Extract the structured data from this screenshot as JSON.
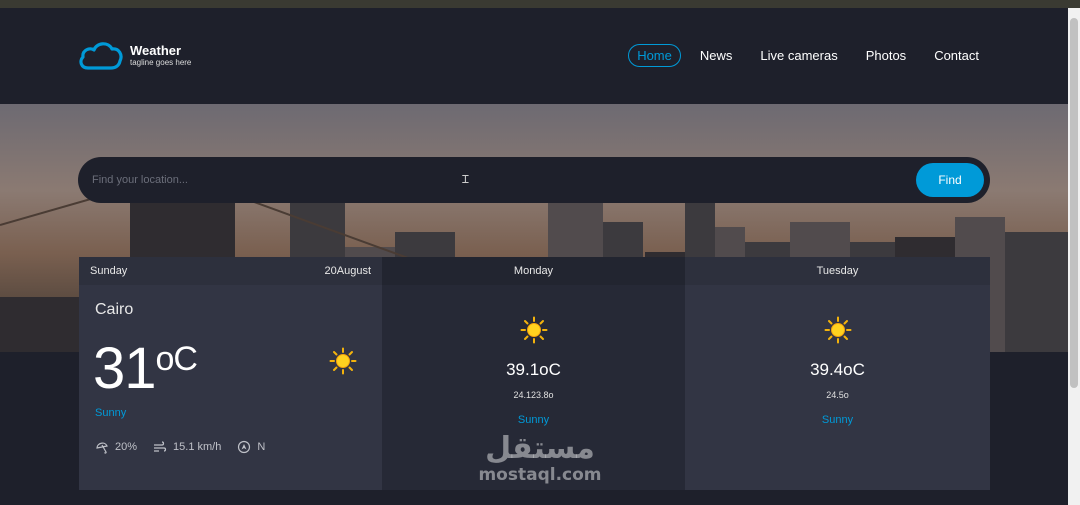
{
  "brand": {
    "name": "Weather",
    "tagline": "tagline goes here",
    "accent": "#009ad8"
  },
  "nav": {
    "items": [
      "Home",
      "News",
      "Live cameras",
      "Photos",
      "Contact"
    ],
    "active": "Home"
  },
  "search": {
    "placeholder": "Find your location...",
    "button": "Find"
  },
  "forecast": {
    "today": {
      "day": "Sunday",
      "date": "20August",
      "city": "Cairo",
      "temp": "31",
      "unit": "oC",
      "condition": "Sunny",
      "icon": "sun-icon",
      "humidity": "20%",
      "wind": "15.1 km/h",
      "direction": "N"
    },
    "days": [
      {
        "day": "Monday",
        "high": "39.1oC",
        "low": "24.123.8o",
        "condition": "Sunny",
        "icon": "sun-icon"
      },
      {
        "day": "Tuesday",
        "high": "39.4oC",
        "low": "24.5o",
        "condition": "Sunny",
        "icon": "sun-icon"
      }
    ]
  },
  "watermark": {
    "arabic": "مستقل",
    "latin": "mostaql.com"
  }
}
